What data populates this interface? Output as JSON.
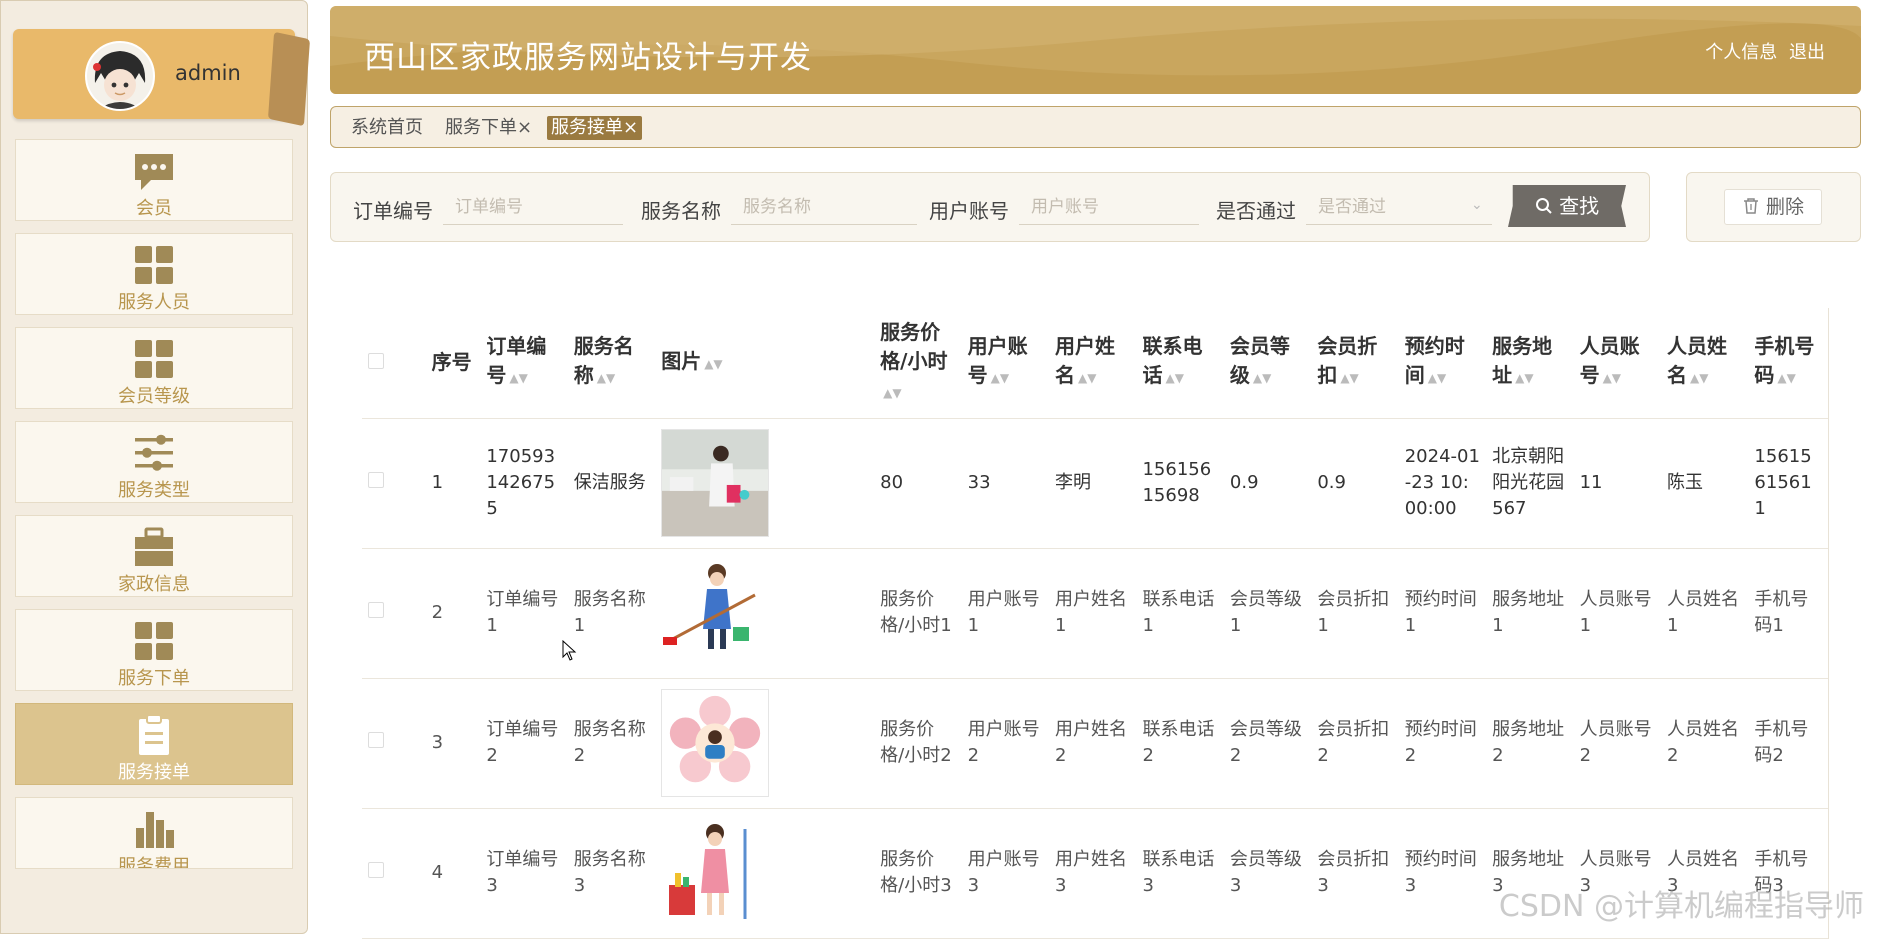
{
  "sidebar": {
    "username": "admin",
    "items": [
      {
        "label": "会员",
        "icon": "chat-bubble-icon"
      },
      {
        "label": "服务人员",
        "icon": "grid-icon"
      },
      {
        "label": "会员等级",
        "icon": "grid-icon"
      },
      {
        "label": "服务类型",
        "icon": "sliders-icon"
      },
      {
        "label": "家政信息",
        "icon": "briefcase-icon"
      },
      {
        "label": "服务下单",
        "icon": "grid-icon"
      },
      {
        "label": "服务接单",
        "icon": "clipboard-icon",
        "active": true
      },
      {
        "label": "服务费用",
        "icon": "bar-chart-icon"
      }
    ]
  },
  "header": {
    "title": "西山区家政服务网站设计与开发",
    "profile_link": "个人信息",
    "logout_link": "退出"
  },
  "tabs": {
    "home": "系统首页",
    "order": "服务下单",
    "accept": "服务接单",
    "close_glyph": "×"
  },
  "search": {
    "order_no_label": "订单编号",
    "order_no_placeholder": "订单编号",
    "service_name_label": "服务名称",
    "service_name_placeholder": "服务名称",
    "user_account_label": "用户账号",
    "user_account_placeholder": "用户账号",
    "approved_label": "是否通过",
    "approved_placeholder": "是否通过",
    "find_button": "查找",
    "delete_button": "删除"
  },
  "table": {
    "headers": [
      "序号",
      "订单编号",
      "服务名称",
      "图片",
      "服务价格/小时",
      "用户账号",
      "用户姓名",
      "联系电话",
      "会员等级",
      "会员折扣",
      "预约时间",
      "服务地址",
      "人员账号",
      "人员姓名",
      "手机号码"
    ],
    "rows": [
      [
        "1",
        "1705931426755",
        "保洁服务",
        "",
        "80",
        "33",
        "李明",
        "15615615698",
        "0.9",
        "0.9",
        "2024-01-23 10:00:00",
        "北京朝阳阳光花园567",
        "11",
        "陈玉",
        "15615615611"
      ],
      [
        "2",
        "订单编号1",
        "服务名称1",
        "",
        "服务价格/小时1",
        "用户账号1",
        "用户姓名1",
        "联系电话1",
        "会员等级1",
        "会员折扣1",
        "预约时间1",
        "服务地址1",
        "人员账号1",
        "人员姓名1",
        "手机号码1"
      ],
      [
        "3",
        "订单编号2",
        "服务名称2",
        "",
        "服务价格/小时2",
        "用户账号2",
        "用户姓名2",
        "联系电话2",
        "会员等级2",
        "会员折扣2",
        "预约时间2",
        "服务地址2",
        "人员账号2",
        "人员姓名2",
        "手机号码2"
      ],
      [
        "4",
        "订单编号3",
        "服务名称3",
        "",
        "服务价格/小时3",
        "用户账号3",
        "用户姓名3",
        "联系电话3",
        "会员等级3",
        "会员折扣3",
        "预约时间3",
        "服务地址3",
        "人员账号3",
        "人员姓名3",
        "手机号码3"
      ]
    ]
  },
  "watermark": "CSDN @计算机编程指导师",
  "colors": {
    "accent": "#c9a65e",
    "sidebar_active": "#dcc48e",
    "tab_active": "#9a7a40",
    "icon": "#a08a57"
  }
}
